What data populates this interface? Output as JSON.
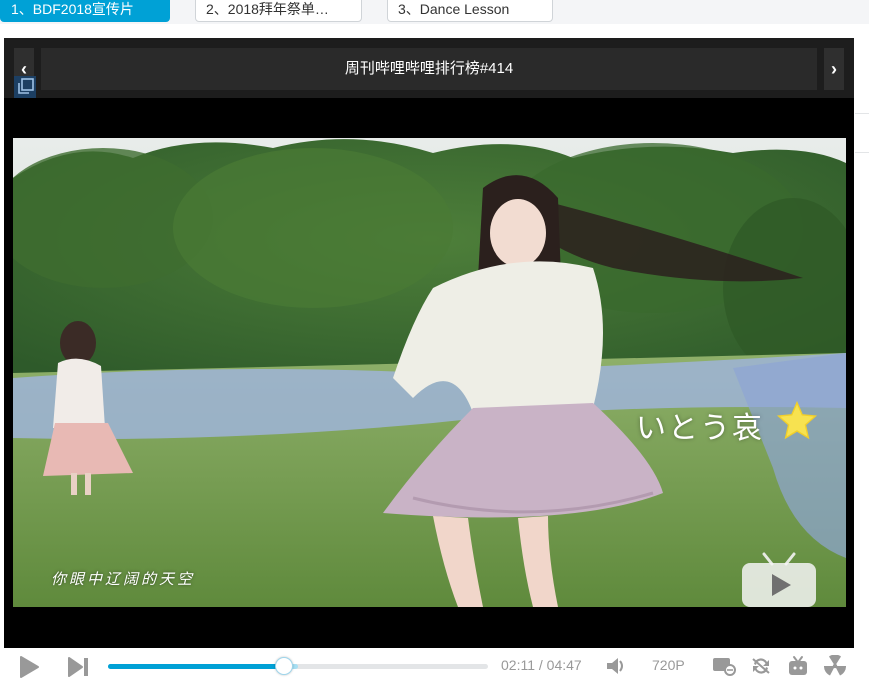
{
  "tabs": [
    {
      "label": "1、BDF2018宣传片",
      "active": true
    },
    {
      "label": "2、2018拜年祭单…",
      "active": false
    },
    {
      "label": "3、Dance Lesson",
      "active": false
    }
  ],
  "player": {
    "title": "周刊哔哩哔哩排行榜#414",
    "overlay_name": "いとう哀",
    "subtitle": "你眼中辽阔的天空"
  },
  "controls": {
    "current_time": "02:11",
    "separator": "/",
    "total_time": "04:47",
    "quality": "720P",
    "played_fraction": 0.46,
    "buffered_fraction": 0.5
  },
  "colors": {
    "accent": "#00a1d6",
    "icon_gray": "#999999"
  }
}
